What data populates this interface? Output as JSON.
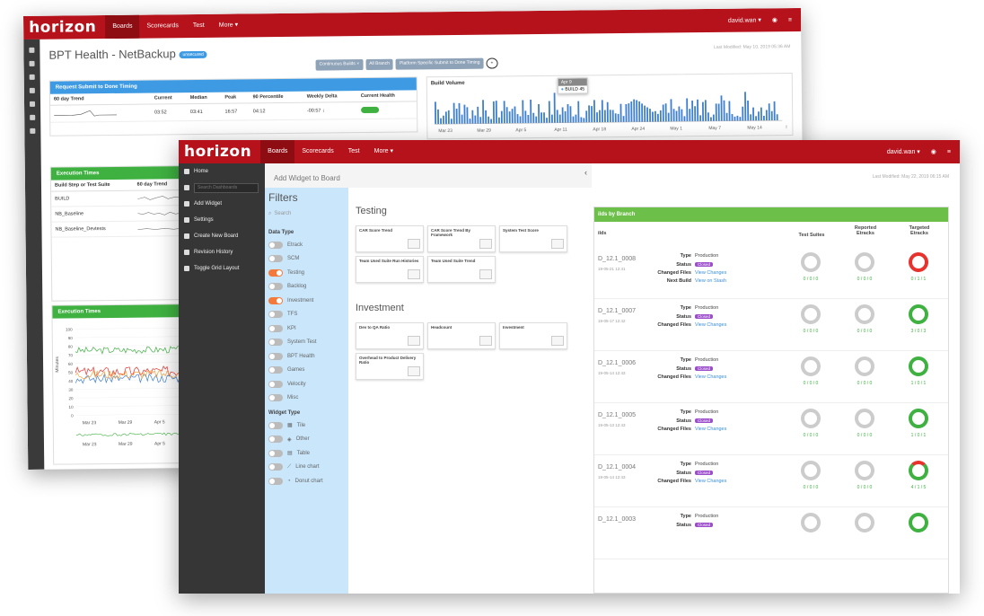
{
  "back": {
    "logo": "horizon",
    "nav": [
      "Boards",
      "Scorecards",
      "Test",
      "More ▾"
    ],
    "user": "david.wan ▾",
    "page_title": "BPT Health - NetBackup",
    "title_pill": "unsecured",
    "filters": [
      "Continuous Builds ×",
      "All Branch",
      "Platform Specific Submit to Done Timing"
    ],
    "last_modified": "Last Modified: May 10, 2019 05:36 AM",
    "timing_card": {
      "title": "Request Submit to Done Timing",
      "headers": [
        "60 day Trend",
        "Current",
        "Median",
        "Peak",
        "90 Percentile",
        "Weekly Delta",
        "Current Health"
      ],
      "row": [
        "",
        "03:52",
        "03:41",
        "16:57",
        "04:12",
        "-00:57 ↓",
        ""
      ]
    },
    "build_volume": {
      "title": "Build Volume",
      "tooltip_date": "Apr 9",
      "tooltip_label": "BUILD",
      "tooltip_value": "45",
      "x_labels": [
        "Mar 23",
        "Mar 29",
        "Apr 5",
        "Apr 11",
        "Apr 18",
        "Apr 24",
        "May 1",
        "May 7",
        "May 14",
        "May 20"
      ]
    },
    "exec_card": {
      "title": "Execution Times",
      "headers": [
        "Build Step or Test Suite",
        "60 day Trend"
      ],
      "rows": [
        "BUILD",
        "NB_Baseline",
        "NB_Baseline_Devtests"
      ]
    },
    "exec_chart": {
      "title": "Execution Times",
      "ylabel": "Minutes",
      "y_ticks": [
        "100",
        "90",
        "80",
        "70",
        "60",
        "50",
        "40",
        "30",
        "20",
        "10",
        "0"
      ],
      "x_labels": [
        "Mar 23",
        "Mar 29",
        "Apr 5"
      ],
      "x_labels2": [
        "Mar 23",
        "Mar 29",
        "Apr 5"
      ],
      "legend": "BU"
    }
  },
  "front": {
    "logo": "horizon",
    "nav": [
      "Boards",
      "Scorecards",
      "Test",
      "More ▾"
    ],
    "user": "david.wan ▾",
    "menu": [
      "Home",
      "Add Widget",
      "Settings",
      "Create New Board",
      "Revision History",
      "Toggle Grid Layout"
    ],
    "search_placeholder": "Search Dashboards",
    "panel_title": "Add Widget to Board",
    "filters_title": "Filters",
    "filter_search": "Search",
    "data_type_label": "Data Type",
    "data_types": [
      {
        "label": "Etrack",
        "on": false
      },
      {
        "label": "SCM",
        "on": false
      },
      {
        "label": "Testing",
        "on": true
      },
      {
        "label": "Backlog",
        "on": false
      },
      {
        "label": "Investment",
        "on": true
      },
      {
        "label": "TFS",
        "on": false
      },
      {
        "label": "KPI",
        "on": false
      },
      {
        "label": "System Test",
        "on": false
      },
      {
        "label": "BPT Health",
        "on": false
      },
      {
        "label": "Games",
        "on": false
      },
      {
        "label": "Velocity",
        "on": false
      },
      {
        "label": "Misc",
        "on": false
      }
    ],
    "widget_type_label": "Widget Type",
    "widget_types": [
      "Tile",
      "Other",
      "Table",
      "Line chart",
      "Donut chart"
    ],
    "sections": [
      {
        "title": "Testing",
        "cards": [
          "CAR Score Trend",
          "CAR Score Trend By Framework",
          "System Test Score",
          "Team Used Suite Run Histories",
          "Team Used Suite Trend"
        ]
      },
      {
        "title": "Investment",
        "cards": [
          "Dev to QA Ratio",
          "Headcount",
          "Investment",
          "Overhead to Product Delivery Ratio"
        ]
      }
    ],
    "last_modified": "Last Modified: May 22, 2019 06:15 AM",
    "builds_title": "ilds by Branch",
    "builds_col": "ilds",
    "col_headers": [
      "Test Suites",
      "Reported Etracks",
      "Targeted Etracks"
    ],
    "builds": [
      {
        "name": "D_12.1_0008",
        "date": "19-05-21 12:41",
        "keys": [
          "Type",
          "Status",
          "Changed Files",
          "Next Build"
        ],
        "vals": [
          "Production",
          "Closed",
          "View Changes",
          "View on Stash"
        ],
        "c1": "0 / 0 / 0",
        "c2": "0 / 0 / 0",
        "c3": "0 / 1 / 1",
        "ring3": "red"
      },
      {
        "name": "D_12.1_0007",
        "date": "19-05-17 12:42",
        "keys": [
          "Type",
          "Status",
          "Changed Files"
        ],
        "vals": [
          "Production",
          "Closed",
          "View Changes"
        ],
        "c1": "0 / 0 / 0",
        "c2": "0 / 0 / 0",
        "c3": "3 / 0 / 3",
        "ring3": "green"
      },
      {
        "name": "D_12.1_0006",
        "date": "19-05-14 12:43",
        "keys": [
          "Type",
          "Status",
          "Changed Files"
        ],
        "vals": [
          "Production",
          "Closed",
          "View Changes"
        ],
        "c1": "0 / 0 / 0",
        "c2": "0 / 0 / 0",
        "c3": "1 / 0 / 1",
        "ring3": "green"
      },
      {
        "name": "D_12.1_0005",
        "date": "19-05-13 12:43",
        "keys": [
          "Type",
          "Status",
          "Changed Files"
        ],
        "vals": [
          "Production",
          "Closed",
          "View Changes"
        ],
        "c1": "0 / 0 / 0",
        "c2": "0 / 0 / 0",
        "c3": "1 / 0 / 1",
        "ring3": "green"
      },
      {
        "name": "D_12.1_0004",
        "date": "19-05-14 12:43",
        "keys": [
          "Type",
          "Status",
          "Changed Files"
        ],
        "vals": [
          "Production",
          "Closed",
          "View Changes"
        ],
        "c1": "0 / 0 / 0",
        "c2": "0 / 0 / 0",
        "c3": "4 / 1 / 5",
        "ring3": "mixed"
      },
      {
        "name": "D_12.1_0003",
        "date": "",
        "keys": [
          "Type",
          "Status"
        ],
        "vals": [
          "Production",
          "Closed"
        ],
        "c1": "",
        "c2": "",
        "c3": "",
        "ring3": "green"
      }
    ]
  },
  "colors": {
    "brand": "#b5121b",
    "accent_blue": "#3e9be3",
    "green": "#3fb141",
    "orange": "#f47a3c",
    "purple": "#9b4dca"
  }
}
